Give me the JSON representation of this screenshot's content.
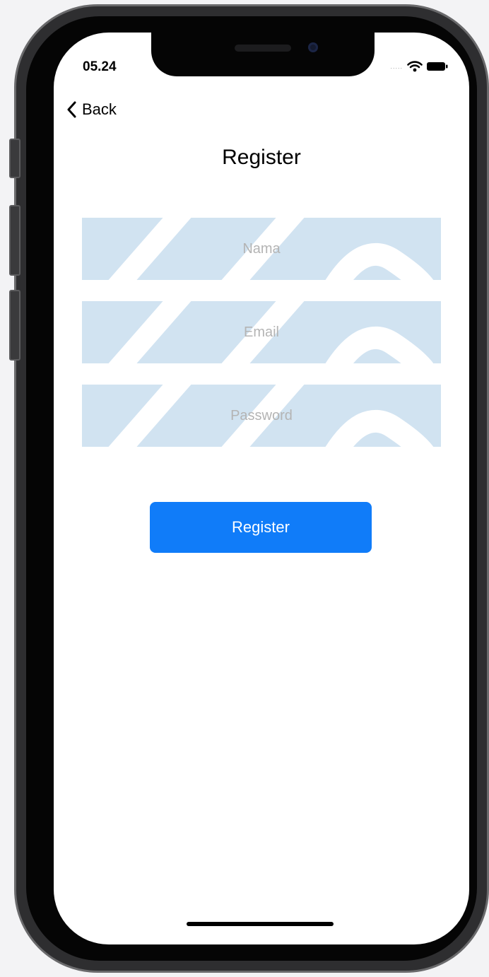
{
  "status_bar": {
    "time": "05.24",
    "signal_dots": "....."
  },
  "nav": {
    "back_label": "Back"
  },
  "page": {
    "title": "Register"
  },
  "form": {
    "name_placeholder": "Nama",
    "email_placeholder": "Email",
    "password_placeholder": "Password",
    "submit_label": "Register"
  },
  "colors": {
    "accent": "#107cf9",
    "field_pattern": "#d1e3f1",
    "background": "#ffffff"
  }
}
